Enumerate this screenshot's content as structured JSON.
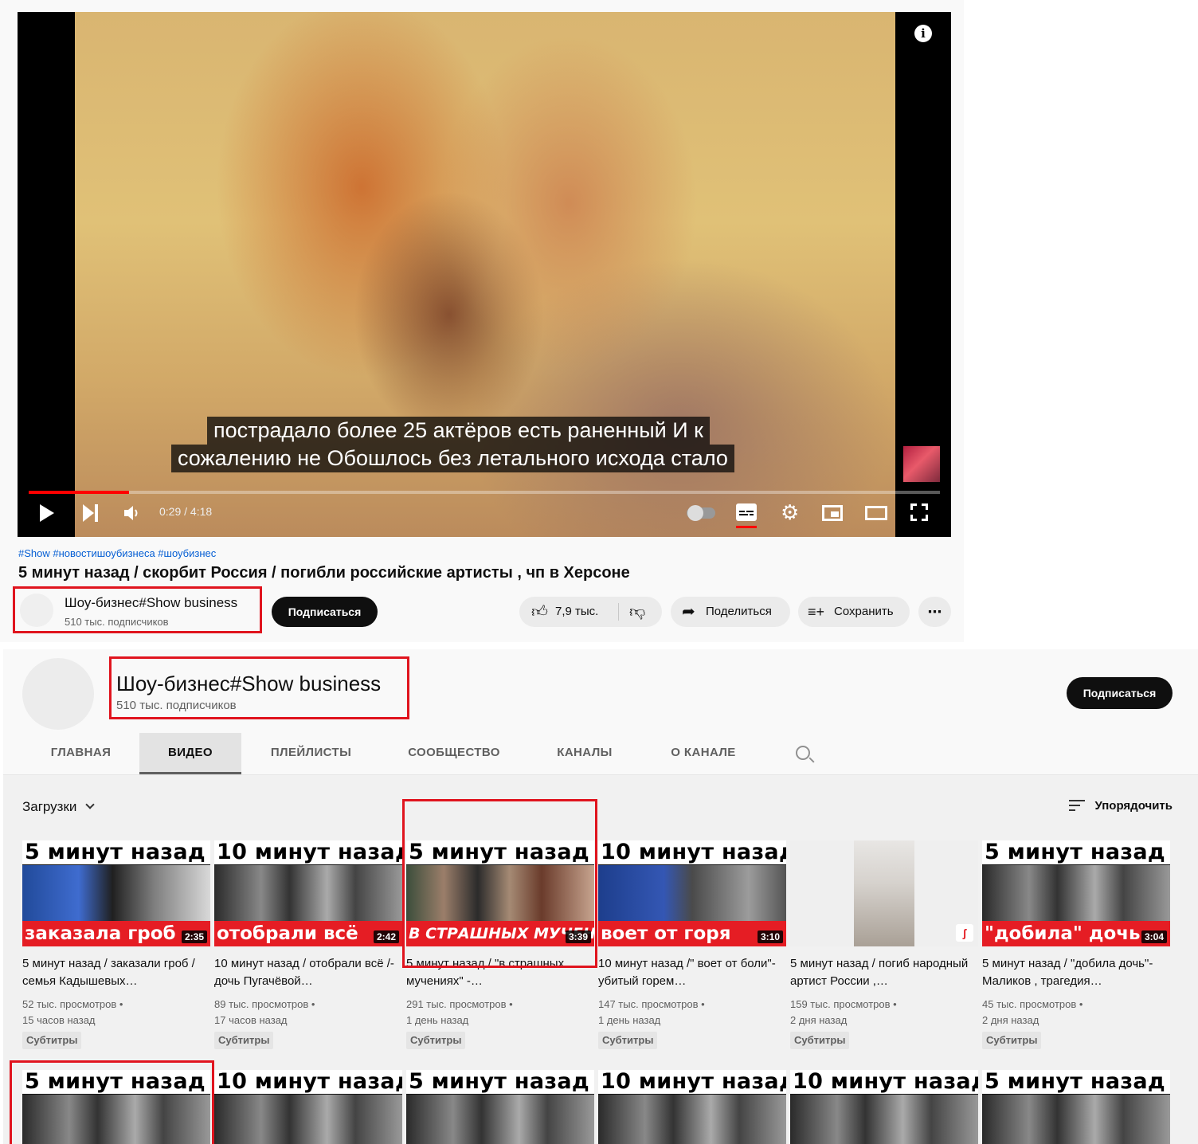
{
  "player": {
    "caption_line1": "пострадало более 25 актёров есть раненный И к",
    "caption_line2": "сожалению не Обошлось без летального исхода стало",
    "time": "0:29 / 4:18",
    "progress_fraction": 0.11,
    "info_icon": "i"
  },
  "video": {
    "hashtags": "#Show #новостишоубизнеса #шоубизнес",
    "title": "5 минут назад / скорбит Россия / погибли российские артисты , чп в Херсоне"
  },
  "owner": {
    "name": "Шоу-бизнес#Show business",
    "subscribers": "510 тыс. подписчиков"
  },
  "actions": {
    "subscribe": "Подписаться",
    "likes": "7,9 тыс.",
    "share": "Поделиться",
    "save": "Сохранить",
    "more": "⋯"
  },
  "channel": {
    "name": "Шоу-бизнес#Show business",
    "subscribers": "510 тыс. подписчиков",
    "subscribe": "Подписаться",
    "tabs": [
      "ГЛАВНАЯ",
      "ВИДЕО",
      "ПЛЕЙЛИСТЫ",
      "СООБЩЕСТВО",
      "КАНАЛЫ",
      "О КАНАЛЕ"
    ],
    "active_tab": "ВИДЕО",
    "uploads": "Загрузки",
    "sort": "Упорядочить"
  },
  "videos": [
    {
      "head": "5 минут назад",
      "foot": "заказала гроб",
      "duration": "2:35",
      "title": "5 минут назад / заказали гроб / семья Кадышевых…",
      "views": "52 тыс. просмотров •",
      "age": "15 часов назад",
      "badge": "Субтитры"
    },
    {
      "head": "10 минут назад",
      "foot": "отобрали всё",
      "duration": "2:42",
      "title": "10 минут назад / отобрали всё /- дочь Пугачёвой…",
      "views": "89 тыс. просмотров •",
      "age": "17 часов назад",
      "badge": "Субтитры"
    },
    {
      "head": "5 минут назад",
      "foot": "В СТРАШНЫХ МУЧЕН",
      "duration": "3:39",
      "title": "5 минут назад / \"в страшных мучениях\" -…",
      "views": "291 тыс. просмотров •",
      "age": "1 день назад",
      "badge": "Субтитры"
    },
    {
      "head": "10 минут назад",
      "foot": "воет от горя",
      "duration": "3:10",
      "title": "10 минут назад /\" воет от боли\"- убитый горем…",
      "views": "147 тыс. просмотров •",
      "age": "1 день назад",
      "badge": "Субтитры"
    },
    {
      "head": "",
      "foot": "",
      "duration": "",
      "title": "5 минут назад / погиб народный артист России ,…",
      "views": "159 тыс. просмотров •",
      "age": "2 дня назад",
      "badge": "Субтитры"
    },
    {
      "head": "5 минут назад",
      "foot": "\"добила\" дочь",
      "duration": "3:04",
      "title": "5 минут назад / \"добила дочь\"- Маликов , трагедия…",
      "views": "45 тыс. просмотров •",
      "age": "2 дня назад",
      "badge": "Субтитры"
    }
  ],
  "videos_row2": [
    {
      "head": "5 минут назад"
    },
    {
      "head": "10 минут назад"
    },
    {
      "head": "5 минут назад"
    },
    {
      "head": "10 минут назад"
    },
    {
      "head": "10 минут назад"
    },
    {
      "head": "5 минут назад"
    }
  ],
  "colors": {
    "accent": "#e51d24",
    "link": "#065fd4",
    "highlight": "#e0141e"
  }
}
